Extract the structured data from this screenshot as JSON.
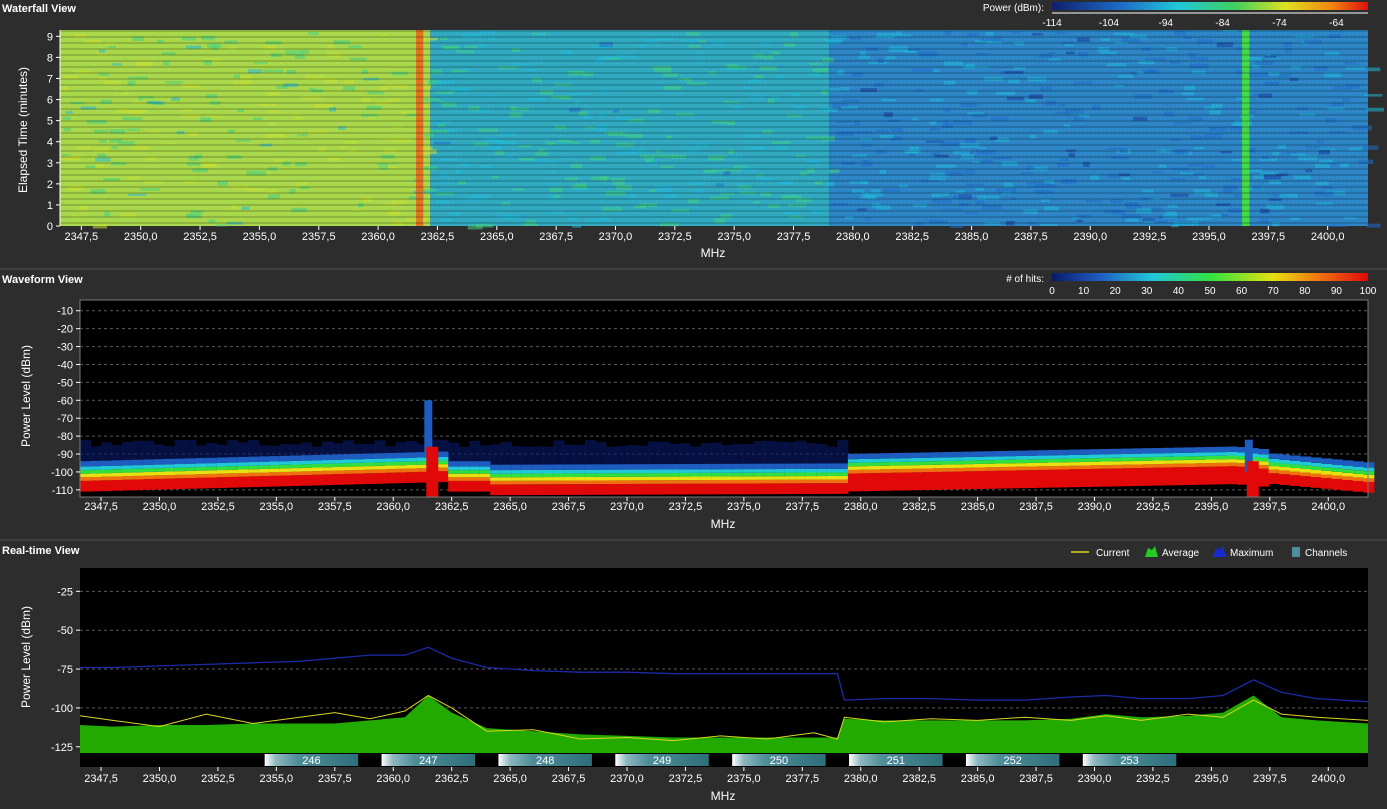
{
  "colors": {
    "background": "#2d2d2d",
    "plot_background": "#000000",
    "current": "#d8d820",
    "average": "#22aa00",
    "maximum": "#1c2aa8",
    "channels": "#4f8e98"
  },
  "waterfall": {
    "title": "Waterfall View",
    "legend_label": "Power (dBm):",
    "legend_ticks": [
      "-114",
      "-104",
      "-94",
      "-84",
      "-74",
      "-64"
    ],
    "ylabel": "Elapsed Time (minutes)",
    "xlabel": "MHz",
    "yticks": [
      "0",
      "1",
      "2",
      "3",
      "4",
      "5",
      "6",
      "7",
      "8",
      "9"
    ]
  },
  "waveform": {
    "title": "Waveform View",
    "legend_label": "# of hits:",
    "legend_ticks": [
      "0",
      "10",
      "20",
      "30",
      "40",
      "50",
      "60",
      "70",
      "80",
      "90",
      "100"
    ],
    "ylabel": "Power Level (dBm)",
    "xlabel": "MHz",
    "yticks": [
      "-10",
      "-20",
      "-30",
      "-40",
      "-50",
      "-60",
      "-70",
      "-80",
      "-90",
      "-100",
      "-110"
    ]
  },
  "realtime": {
    "title": "Real-time View",
    "legend": [
      "Current",
      "Average",
      "Maximum",
      "Channels"
    ],
    "ylabel": "Power Level (dBm)",
    "xlabel": "MHz",
    "yticks": [
      "-25",
      "-50",
      "-75",
      "-100",
      "-125"
    ]
  },
  "xticks": [
    "2347,5",
    "2350,0",
    "2352,5",
    "2355,0",
    "2357,5",
    "2360,0",
    "2362,5",
    "2365,0",
    "2367,5",
    "2370,0",
    "2372,5",
    "2375,0",
    "2377,5",
    "2380,0",
    "2382,5",
    "2385,0",
    "2387,5",
    "2390,0",
    "2392,5",
    "2395,0",
    "2397,5",
    "2400,0"
  ],
  "chart_data": [
    {
      "type": "heatmap",
      "title": "Waterfall View",
      "xlabel": "MHz",
      "ylabel": "Elapsed Time (minutes)",
      "xlim": [
        2346.6,
        2401.7
      ],
      "ylim": [
        0,
        9.3
      ],
      "colorbar_label": "Power (dBm):",
      "colorbar_range": [
        -114,
        -60
      ],
      "regions": [
        {
          "x": [
            2346.6,
            2362.2
          ],
          "level_dbm": -84
        },
        {
          "x": [
            2361.6,
            2361.9
          ],
          "level_dbm": -74
        },
        {
          "x": [
            2362.2,
            2379.0
          ],
          "level_dbm": -92
        },
        {
          "x": [
            2379.0,
            2401.7
          ],
          "level_dbm": -102
        },
        {
          "x": [
            2396.4,
            2396.7
          ],
          "level_dbm": -90
        }
      ]
    },
    {
      "type": "heatmap",
      "title": "Waveform View",
      "xlabel": "MHz",
      "ylabel": "Power Level (dBm)",
      "xlim": [
        2346.6,
        2401.7
      ],
      "ylim": [
        -114,
        -4
      ],
      "colorbar_label": "# of hits:",
      "colorbar_range": [
        0,
        100
      ],
      "grid": true
    },
    {
      "type": "line",
      "title": "Real-time View",
      "xlabel": "MHz",
      "ylabel": "Power Level (dBm)",
      "xlim": [
        2346.6,
        2401.7
      ],
      "ylim": [
        -138,
        -10
      ],
      "grid": true,
      "legend_position": "top-right",
      "x": [
        2346.6,
        2348,
        2350,
        2352,
        2354,
        2356,
        2357.5,
        2359,
        2360.5,
        2361.5,
        2362.5,
        2364,
        2366,
        2368,
        2370,
        2372,
        2374,
        2376,
        2378,
        2379.0,
        2379.3,
        2381,
        2383,
        2385,
        2387,
        2389,
        2390.5,
        2392,
        2394,
        2395.5,
        2396.8,
        2398,
        2399.5,
        2401.7
      ],
      "series": [
        {
          "name": "Maximum",
          "values": [
            -74,
            -74,
            -73,
            -72,
            -71,
            -70,
            -68,
            -66,
            -66,
            -61,
            -68,
            -74,
            -76,
            -77,
            -77,
            -78,
            -78,
            -78,
            -78,
            -78,
            -95,
            -94,
            -94,
            -95,
            -95,
            -93,
            -92,
            -94,
            -94,
            -92,
            -82,
            -90,
            -94,
            -96
          ]
        },
        {
          "name": "Average",
          "values": [
            -111,
            -112,
            -111,
            -111,
            -110,
            -110,
            -110,
            -108,
            -106,
            -92,
            -103,
            -113,
            -115,
            -117,
            -118,
            -119,
            -119,
            -119,
            -119,
            -119,
            -107,
            -108,
            -108,
            -108,
            -108,
            -107,
            -104,
            -106,
            -105,
            -103,
            -92,
            -106,
            -108,
            -110
          ]
        },
        {
          "name": "Current",
          "values": [
            -105,
            -108,
            -112,
            -104,
            -110,
            -106,
            -103,
            -107,
            -102,
            -92,
            -100,
            -115,
            -114,
            -120,
            -119,
            -121,
            -118,
            -120,
            -116,
            -120,
            -106,
            -109,
            -107,
            -108,
            -106,
            -108,
            -105,
            -108,
            -104,
            -106,
            -95,
            -104,
            -106,
            -108
          ]
        }
      ],
      "channels": [
        {
          "label": "246",
          "x": [
            2354.5,
            2358.5
          ]
        },
        {
          "label": "247",
          "x": [
            2359.5,
            2363.5
          ]
        },
        {
          "label": "248",
          "x": [
            2364.5,
            2368.5
          ]
        },
        {
          "label": "249",
          "x": [
            2369.5,
            2373.5
          ]
        },
        {
          "label": "250",
          "x": [
            2374.5,
            2378.5
          ]
        },
        {
          "label": "251",
          "x": [
            2379.5,
            2383.5
          ]
        },
        {
          "label": "252",
          "x": [
            2384.5,
            2388.5
          ]
        },
        {
          "label": "253",
          "x": [
            2389.5,
            2393.5
          ]
        }
      ]
    }
  ]
}
